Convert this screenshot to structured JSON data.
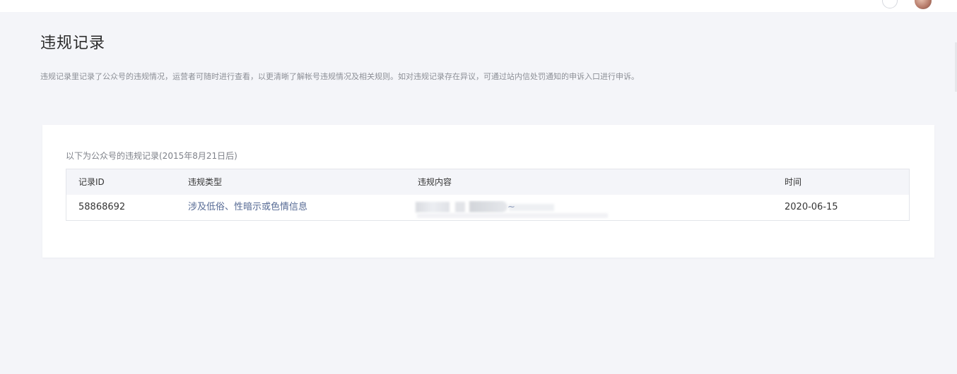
{
  "page": {
    "title": "违规记录",
    "description": "违规记录里记录了公众号的违规情况，运营者可随时进行查看，以更清晰了解帐号违规情况及相关规则。如对违规记录存在异议，可通过站内信处罚通知的申诉入口进行申诉。"
  },
  "records": {
    "caption": "以下为公众号的违规记录(2015年8月21日后)",
    "columns": [
      "记录ID",
      "违规类型",
      "违规内容",
      "时间"
    ],
    "rows": [
      {
        "id": "58868692",
        "type": "涉及低俗、性暗示或色情信息",
        "content_visible_tail": "~",
        "time": "2020-06-15"
      }
    ]
  },
  "colors": {
    "link": "#576b95",
    "background": "#f4f5f9",
    "card": "#ffffff"
  },
  "icons": {
    "top_right": [
      "help-icon",
      "user-avatar"
    ]
  }
}
